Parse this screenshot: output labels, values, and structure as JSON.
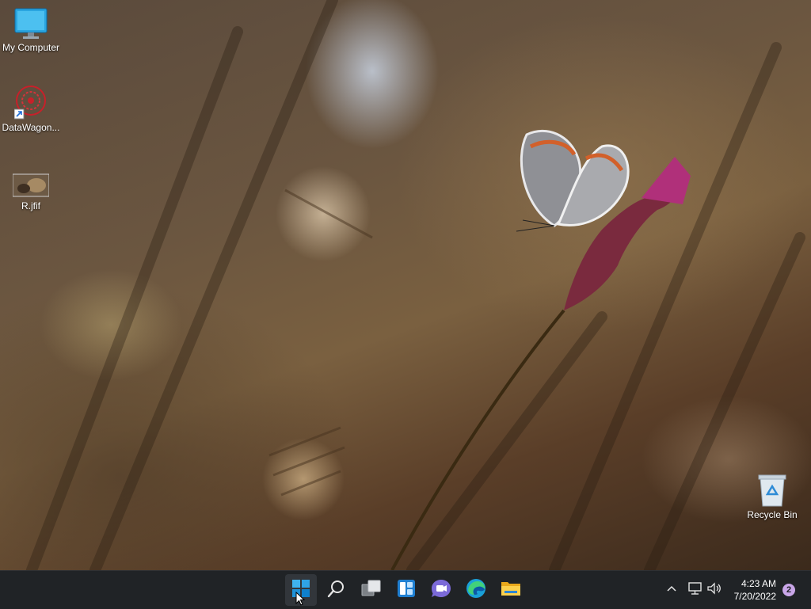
{
  "desktop": {
    "icons": [
      {
        "label": "My Computer",
        "icon": "computer-icon"
      },
      {
        "label": "DataWagon...",
        "icon": "datawagon-shortcut-icon"
      },
      {
        "label": "R.jfif",
        "icon": "image-file-icon"
      },
      {
        "label": "Recycle Bin",
        "icon": "recycle-bin-icon"
      }
    ]
  },
  "taskbar": {
    "apps": [
      {
        "name": "Start",
        "icon": "windows-logo-icon"
      },
      {
        "name": "Search",
        "icon": "search-icon"
      },
      {
        "name": "Task View",
        "icon": "task-view-icon"
      },
      {
        "name": "Widgets",
        "icon": "widgets-icon"
      },
      {
        "name": "Chat",
        "icon": "chat-icon"
      },
      {
        "name": "Edge",
        "icon": "edge-icon"
      },
      {
        "name": "File Explorer",
        "icon": "folder-icon"
      }
    ],
    "tray": {
      "chevron": "chevron-up-icon",
      "network": "network-icon",
      "volume": "volume-icon",
      "time": "4:23 AM",
      "date": "7/20/2022",
      "notifications": "2"
    }
  },
  "colors": {
    "taskbar": "#202326",
    "accent": "#0078d4",
    "badge": "#c9a6e8"
  }
}
